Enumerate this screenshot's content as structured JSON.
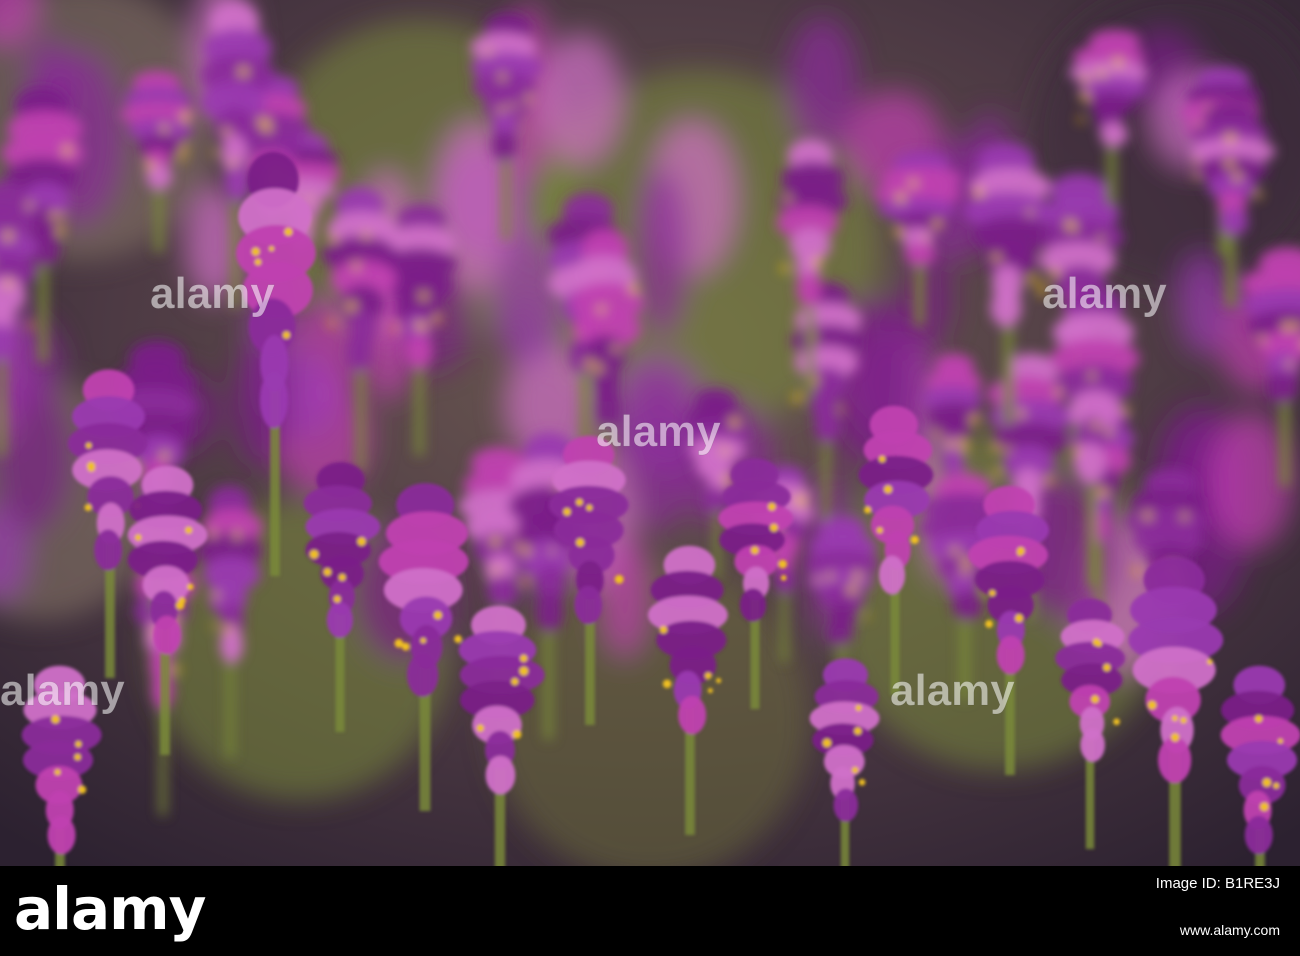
{
  "photo": {
    "subject": "field of purple owl's clover flowers",
    "palette": {
      "background_dark": "#3e2f3a",
      "background_warm": "#8a7a6a",
      "foliage_green": "#7a8a3a",
      "flower_purple": "#8a2a9a",
      "flower_magenta": "#c040b0",
      "flower_pink": "#d070c8",
      "flower_yellow": "#f0c020"
    }
  },
  "watermark": {
    "left_text": "alamy",
    "right_text": "alamy",
    "bottom_left_text": "alamy",
    "bottom_right_text": "alamy",
    "center_text": "alamy"
  },
  "footer": {
    "logo": "alamy",
    "image_id": "Image ID: B1RE3J",
    "url": "www.alamy.com"
  }
}
